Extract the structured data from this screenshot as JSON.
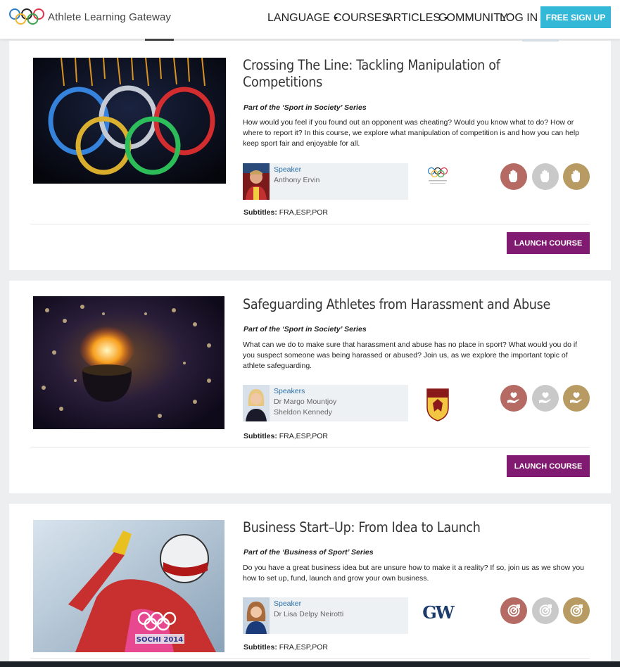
{
  "header": {
    "brand": "Athlete Learning Gateway",
    "nav": [
      "LANGUAGE",
      "COURSES",
      "ARTICLES",
      "COMMUNITY",
      "LOG IN"
    ],
    "signup": "FREE SIGN UP"
  },
  "courses": [
    {
      "title": "Crossing The Line: Tackling Manipulation of Competitions",
      "series": "Part of the ‘Sport in Society’ Series",
      "description": "How would you feel if you found out an opponent was cheating? Would you know what to do? How or where to report it? In this course, we explore what manipulation of competition is and how you can help keep sport fair and enjoyable for all.",
      "speaker_label": "Speaker",
      "speakers": [
        "Anthony Ervin"
      ],
      "subtitles_label": "Subtitles:",
      "subtitles": "FRA,ESP,POR",
      "launch": "LAUNCH COURSE"
    },
    {
      "title": "Safeguarding Athletes from Harassment and Abuse",
      "series": "Part of the ‘Sport in Society’ Series",
      "description": "What can we do to make sure that harassment and abuse has no place in sport? What would you do if you suspect someone was being harassed or abused? Join us, as we explore the important topic of athlete safeguarding.",
      "speaker_label": "Speakers",
      "speakers": [
        "Dr Margo Mountjoy",
        "Sheldon Kennedy"
      ],
      "subtitles_label": "Subtitles:",
      "subtitles": "FRA,ESP,POR",
      "launch": "LAUNCH COURSE"
    },
    {
      "title": "Business Start–Up: From Idea to Launch",
      "series": "Part of the ‘Business of Sport’ Series",
      "description": "Do you have a great business idea but are unsure how to make it a reality? If so, join us as we show you how to set up, fund, launch and grow your own business.",
      "speaker_label": "Speaker",
      "speakers": [
        "Dr Lisa Delpy Neirotti"
      ],
      "subtitles_label": "Subtitles:",
      "subtitles": "FRA,ESP,POR",
      "org_logo_text": "GW"
    }
  ],
  "colors": {
    "signup": "#34b8d8",
    "launch": "#801b71",
    "badge_red": "#b56a64",
    "badge_grey": "#c9c9c9",
    "badge_gold": "#b89b62",
    "speaker_label": "#2a6fa8"
  },
  "icons": [
    "olympic-rings-icon",
    "caret-down-icon",
    "hand-stop-icon",
    "hand-heart-icon",
    "target-icon"
  ]
}
